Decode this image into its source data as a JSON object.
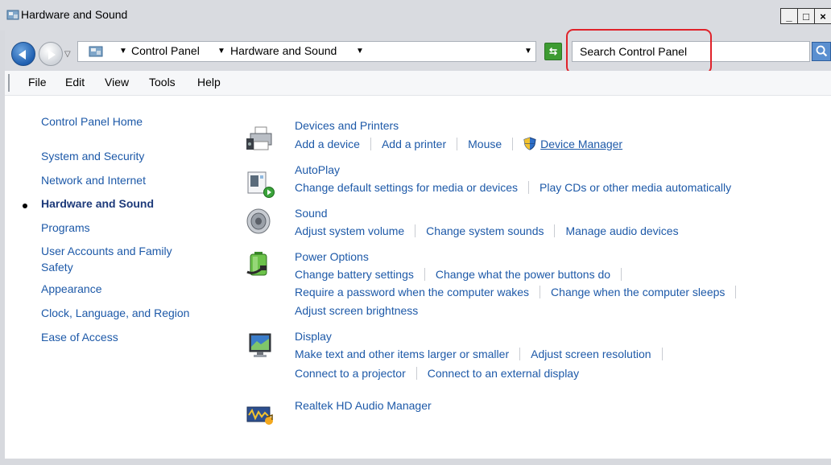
{
  "window": {
    "title": "Hardware and Sound",
    "buttons": {
      "minimize": "_",
      "maximize": "□",
      "close": "×"
    }
  },
  "address_bar": {
    "crumbs": [
      "Control Panel",
      "Hardware and Sound"
    ],
    "search_placeholder": "Search Control Panel"
  },
  "menu": [
    "File",
    "Edit",
    "View",
    "Tools",
    "Help"
  ],
  "left_nav": {
    "home": "Control Panel Home",
    "items": [
      "System and Security",
      "Network and Internet",
      "Hardware and Sound",
      "Programs",
      "User Accounts and Family",
      "Safety",
      "Appearance",
      "Clock, Language, and Region",
      "Ease of Access"
    ],
    "current": "Hardware and Sound"
  },
  "categories": [
    {
      "title": "Devices and Printers",
      "icon": "printer-icon",
      "lines": [
        [
          "Add a device",
          "Add a printer",
          "Mouse",
          "Device Manager"
        ]
      ]
    },
    {
      "title": "AutoPlay",
      "icon": "autoplay-icon",
      "lines": [
        [
          "Change default settings for media or devices",
          "Play CDs or other media automatically"
        ]
      ]
    },
    {
      "title": "Sound",
      "icon": "speaker-icon",
      "lines": [
        [
          "Adjust system volume",
          "Change system sounds",
          "Manage audio devices"
        ]
      ]
    },
    {
      "title": "Power Options",
      "icon": "battery-icon",
      "lines": [
        [
          "Change battery settings",
          "Change what the power buttons do"
        ],
        [
          "Require a password when the computer wakes",
          "Change when the computer sleeps"
        ],
        [
          "Adjust screen brightness"
        ]
      ]
    },
    {
      "title": "Display",
      "icon": "monitor-icon",
      "lines": [
        [
          "Make text and other items larger or smaller",
          "Adjust screen resolution"
        ],
        [
          "Connect to a projector",
          "Connect to an external display"
        ]
      ]
    },
    {
      "title": "Realtek HD Audio Manager",
      "icon": "realtek-icon",
      "lines": []
    }
  ]
}
